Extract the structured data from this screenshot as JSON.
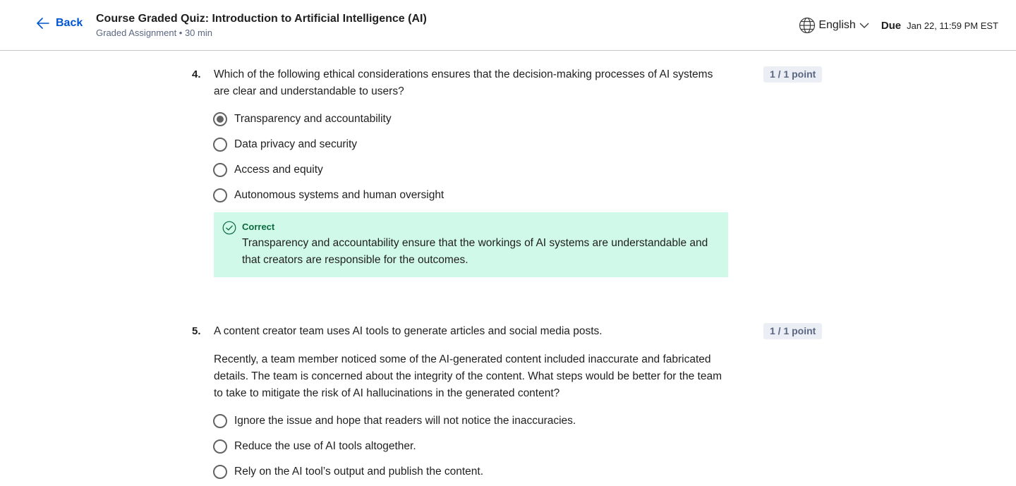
{
  "header": {
    "back_label": "Back",
    "title": "Course Graded Quiz: Introduction to Artificial Intelligence (AI)",
    "subtitle": "Graded Assignment • 30 min",
    "language": "English",
    "due_label": "Due",
    "due_value": "Jan 22, 11:59 PM EST"
  },
  "questions": [
    {
      "number": "4.",
      "text": "Which of the following ethical considerations ensures that the decision-making processes of AI systems are clear and understandable to users?",
      "points": "1 / 1 point",
      "options": [
        {
          "label": "Transparency and accountability",
          "selected": true
        },
        {
          "label": "Data privacy and security",
          "selected": false
        },
        {
          "label": "Access and equity",
          "selected": false
        },
        {
          "label": "Autonomous systems and human oversight",
          "selected": false
        }
      ],
      "feedback": {
        "status": "Correct",
        "text": "Transparency and accountability ensure that the workings of AI systems are understandable and that creators are responsible for the outcomes."
      }
    },
    {
      "number": "5.",
      "text": "A content creator team uses AI tools to generate articles and social media posts.",
      "text2": "Recently, a team member noticed some of the AI-generated content included inaccurate and fabricated details. The team is concerned about the integrity of the content. What steps would be better for the team to take to mitigate the risk of AI hallucinations in the generated content?",
      "points": "1 / 1 point",
      "options": [
        {
          "label": "Ignore the issue and hope that readers will not notice the inaccuracies.",
          "selected": false
        },
        {
          "label": "Reduce the use of AI tools altogether.",
          "selected": false
        },
        {
          "label": "Rely on the AI tool’s output and publish the content.",
          "selected": false
        }
      ]
    }
  ],
  "colors": {
    "accent": "#0056d2",
    "correct_bg": "#d1f9ea",
    "correct_text": "#0b6a3e",
    "points_bg": "#ebeff5"
  }
}
